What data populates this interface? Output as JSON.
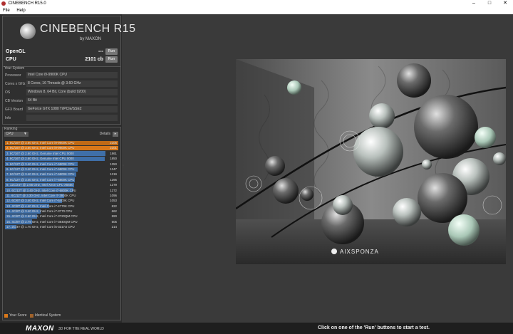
{
  "window": {
    "title": "CINEBENCH R15.0",
    "controls": [
      "–",
      "□",
      "✕"
    ]
  },
  "menu": {
    "file": "File",
    "help": "Help"
  },
  "logo": {
    "title": "CINEBENCH R15",
    "subtitle": "by MAXON"
  },
  "scores": {
    "opengl": {
      "label": "OpenGL",
      "value": "---",
      "run": "Run"
    },
    "cpu": {
      "label": "CPU",
      "value": "2101 cb",
      "run": "Run"
    }
  },
  "system": {
    "title": "Your System",
    "rows": [
      {
        "key": "Processor",
        "value": "Intel Core i9-9900K CPU"
      },
      {
        "key": "Cores x GHz",
        "value": "8 Cores, 16 Threads @ 3.60 GHz"
      },
      {
        "key": "OS",
        "value": "Windows 8, 64 Bit, Core (build 9200)"
      },
      {
        "key": "CB Version",
        "value": "64 Bit"
      },
      {
        "key": "GFX Board",
        "value": "GeForce GTX 1080 Ti/PCIe/SSE2"
      },
      {
        "key": "Info",
        "value": ""
      }
    ]
  },
  "ranking": {
    "title": "Ranking",
    "selected": "CPU",
    "details": "Details",
    "max_score": 2106,
    "rows": [
      {
        "label": "1. 8C/16T @ 3.60 GHz, Intel Core i9-9900K CPU",
        "score": "2106",
        "value": 2106,
        "color": "#c06a16"
      },
      {
        "label": "2. 8C/16T @ 3.60 GHz, Intel Core i9-9900K CPU",
        "score": "2101",
        "value": 2101,
        "color": "#d9781a"
      },
      {
        "label": "3. 8C/16T @ 2.60 GHz, Genuine Intel CPU 0000",
        "score": "1861",
        "value": 1861,
        "color": "#3f6fa8"
      },
      {
        "label": "4. 8C/16T @ 2.60 GHz, Genuine Intel CPU 0000",
        "score": "1850",
        "value": 1850,
        "color": "#3f6fa8"
      },
      {
        "label": "5. 6C/12T @ 3.40 GHz, Intel Core i7-6800K CPU",
        "score": "1350",
        "value": 1350,
        "color": "#3f6fa8"
      },
      {
        "label": "6. 6C/12T @ 3.40 GHz, Intel Core i7-6800K CPU",
        "score": "1347",
        "value": 1347,
        "color": "#3f6fa8"
      },
      {
        "label": "7. 6C/12T @ 3.40 GHz, Intel Core i7-6800K CPU",
        "score": "1319",
        "value": 1319,
        "color": "#3f6fa8"
      },
      {
        "label": "8. 6C/12T @ 3.40 GHz, Intel Core i7-6800K CPU",
        "score": "1295",
        "value": 1295,
        "color": "#3f6fa8"
      },
      {
        "label": "9. 12C/24T @ 2.66 GHz, Intel Xeon CPU X5650",
        "score": "1279",
        "value": 1279,
        "color": "#3f6fa8"
      },
      {
        "label": "10. 6C/12T @ 3.40 GHz, Intel Core i7-6800K CPU",
        "score": "1272",
        "value": 1272,
        "color": "#3f6fa8"
      },
      {
        "label": "11. 6C/12T @ 3.30 GHz, Intel Core i7-3930K CPU",
        "score": "1096",
        "value": 1096,
        "color": "#3f6fa8"
      },
      {
        "label": "12. 6C/6T @ 3.40 GHz, Intel Core i7-6400K CPU",
        "score": "1053",
        "value": 1053,
        "color": "#3f6fa8"
      },
      {
        "label": "13. 4C/8T @ 4.40 GHz, Intel Core i7-4770K CPU",
        "score": "822",
        "value": 822,
        "color": "#3f6fa8"
      },
      {
        "label": "14. 4C/8T @ 3.40 GHz, Intel Core i7-3770 CPU",
        "score": "662",
        "value": 662,
        "color": "#3f6fa8"
      },
      {
        "label": "15. 4C/8T @ 2.60 GHz, Intel Core i7-3720QM CPU",
        "score": "590",
        "value": 590,
        "color": "#3f6fa8"
      },
      {
        "label": "16. 4C/8T @ 2.79 GHz, Intel Core i7-3840QM CPU",
        "score": "505",
        "value": 505,
        "color": "#3f6fa8"
      },
      {
        "label": "17. 2C/4T @ 1.70 GHz, Intel Core i5-3317U CPU",
        "score": "214",
        "value": 214,
        "color": "#3f6fa8"
      }
    ]
  },
  "legend": {
    "your_score": {
      "label": "Your Score",
      "color": "#d9781a"
    },
    "identical": {
      "label": "Identical System",
      "color": "#a0622a"
    }
  },
  "footer": {
    "brand": "MAXON",
    "tagline": "3D FOR THE REAL WORLD",
    "status": "Click on one of the 'Run' buttons to start a test."
  },
  "render": {
    "watermark": "AIXSPONZA"
  }
}
